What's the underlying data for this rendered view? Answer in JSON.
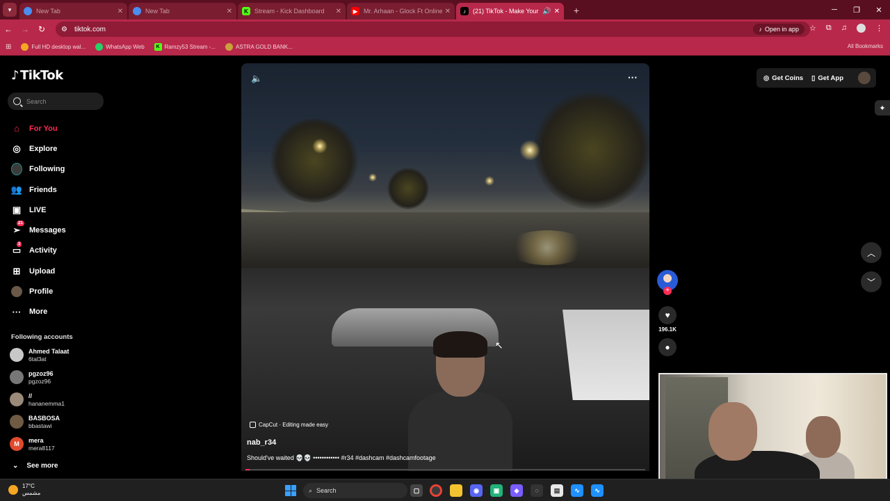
{
  "browser": {
    "tabs": [
      {
        "title": "New Tab",
        "favicon": "chrome",
        "color": "#4a8ef0",
        "active": false
      },
      {
        "title": "New Tab",
        "favicon": "chrome",
        "color": "#4a8ef0",
        "active": false
      },
      {
        "title": "Stream - Kick Dashboard",
        "favicon": "K",
        "color": "#53fc18",
        "active": false
      },
      {
        "title": "Mr. Arhaan - Glock Ft Online C...",
        "favicon": "youtube",
        "color": "#ff0000",
        "active": false
      },
      {
        "title": "(21) TikTok - Make Your Day",
        "favicon": "tiktok",
        "color": "#000000",
        "active": true
      }
    ],
    "url": "tiktok.com",
    "open_in_app": "Open in app",
    "bookmarks": [
      {
        "label": "Full HD desktop wal...",
        "icon": "globe-icon",
        "color": "#f5a623"
      },
      {
        "label": "WhatsApp Web",
        "icon": "whatsapp-icon",
        "color": "#25d366"
      },
      {
        "label": "Ramzy53 Stream -...",
        "icon": "kick-icon",
        "color": "#53fc18"
      },
      {
        "label": "ASTRA GOLD BANK...",
        "icon": "astra-icon",
        "color": "#c9a13b"
      }
    ],
    "all_bookmarks": "All Bookmarks"
  },
  "tiktok": {
    "logo": "TikTok",
    "search_placeholder": "Search",
    "menu": [
      {
        "label": "For You",
        "icon": "home-icon",
        "selected": true
      },
      {
        "label": "Explore",
        "icon": "compass-icon"
      },
      {
        "label": "Following",
        "icon": "following-avatar-icon"
      },
      {
        "label": "Friends",
        "icon": "friends-icon"
      },
      {
        "label": "LIVE",
        "icon": "live-icon"
      },
      {
        "label": "Messages",
        "icon": "messages-icon",
        "badge": "21"
      },
      {
        "label": "Activity",
        "icon": "activity-icon",
        "badge": "3"
      },
      {
        "label": "Upload",
        "icon": "upload-icon"
      },
      {
        "label": "Profile",
        "icon": "profile-avatar-icon"
      },
      {
        "label": "More",
        "icon": "more-icon"
      }
    ],
    "following_header": "Following accounts",
    "following": [
      {
        "name": "Ahmed Talaat",
        "handle": "6tal3at"
      },
      {
        "name": "pgzoz96",
        "handle": "pgzoz96"
      },
      {
        "name": "//",
        "handle": "hananemma1"
      },
      {
        "name": "BASBOSA",
        "handle": "bbastawi"
      },
      {
        "name": "mera",
        "handle": "mera8117"
      }
    ],
    "see_more": "See more",
    "video": {
      "capcut": "CapCut · Editing made easy",
      "username": "nab_r34",
      "description": "Should've waited 💀💀 •••••••••••• #r34 #dashcam #dashcamfootage",
      "likes": "196.1K",
      "progress": 0.01
    },
    "top_right": {
      "get_coins": "Get Coins",
      "get_app": "Get App"
    }
  },
  "taskbar": {
    "temperature": "17°C",
    "weather_text": "مشمس",
    "search": "Search"
  }
}
